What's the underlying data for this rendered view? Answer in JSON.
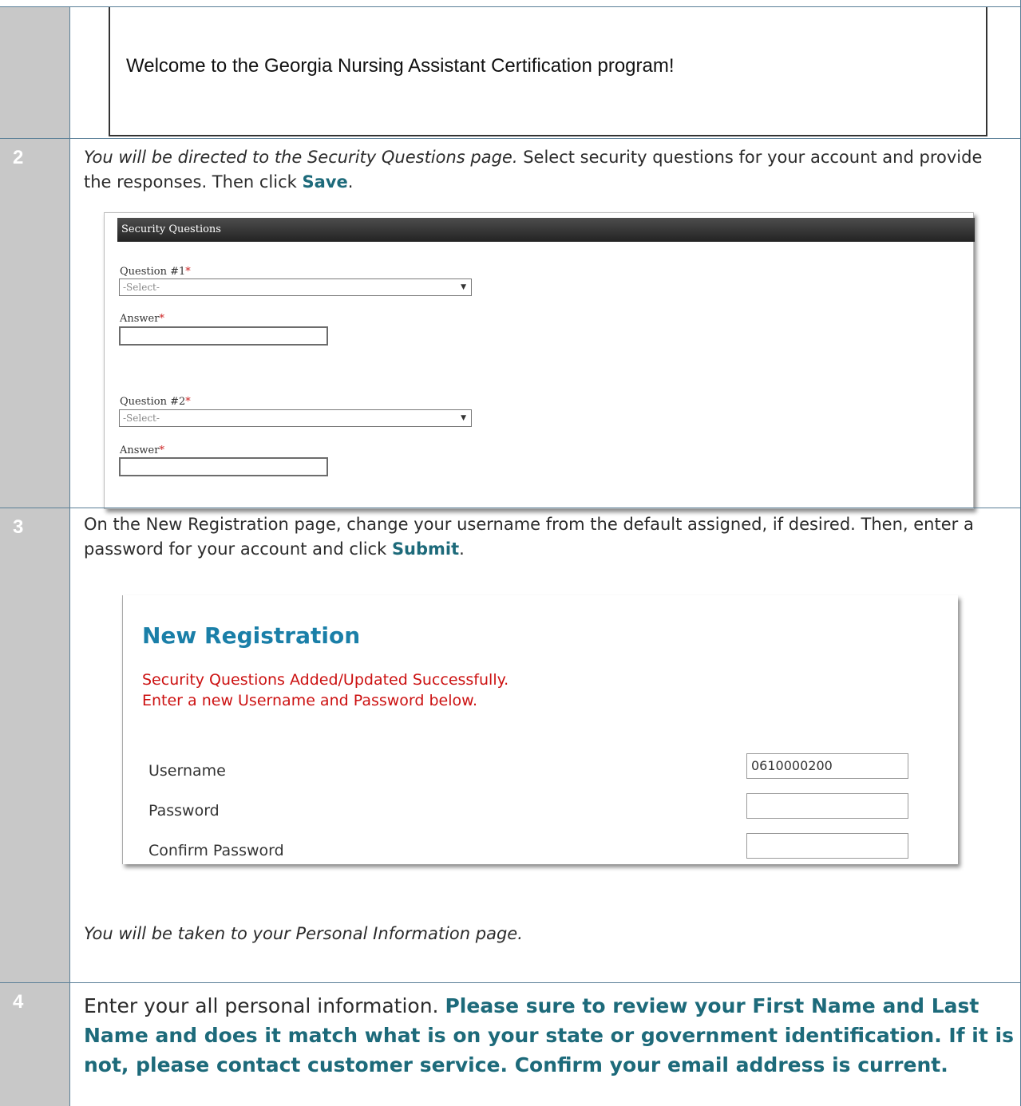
{
  "row1": {
    "welcome_text": "Welcome to the Georgia Nursing Assistant Certification program!"
  },
  "step2": {
    "number": "2",
    "intro_italic": "You will be directed to the Security Questions page.",
    "intro_text_a": " Select security questions for your account and provide the responses. Then click ",
    "intro_bold": "Save",
    "intro_text_b": ".",
    "screenshot": {
      "bar_title": "Security Questions",
      "question1_label": "Question #1",
      "question1_value": "-Select-",
      "answer1_label": "Answer",
      "question2_label": "Question #2",
      "question2_value": "-Select-",
      "answer2_label": "Answer",
      "required_mark": "*"
    }
  },
  "step3": {
    "number": "3",
    "intro_text_a": "On the New Registration page, change your username from the default assigned, if desired. Then, enter a password for your account and click ",
    "intro_bold": "Submit",
    "intro_text_b": ".",
    "screenshot": {
      "title": "New Registration",
      "message_line1": "Security Questions Added/Updated Successfully.",
      "message_line2": "Enter a new Username and Password below.",
      "username_label": "Username",
      "username_value": "0610000200",
      "password_label": "Password",
      "confirm_label": "Confirm Password"
    },
    "outro_italic": "You will be taken to your Personal Information page."
  },
  "step4": {
    "number": "4",
    "text_plain": "Enter your all personal information. ",
    "text_bold": "Please sure to review your First Name and Last Name and does it match what is on your state or government identification.  If it is not, please contact customer service.  Confirm your email address is current."
  },
  "colors": {
    "number_column": "#c8c8c8",
    "grid_line": "#5a7f97",
    "highlight": "#1d6a7a",
    "registration_title": "#1a7fa8",
    "success_message": "#cc1111"
  }
}
